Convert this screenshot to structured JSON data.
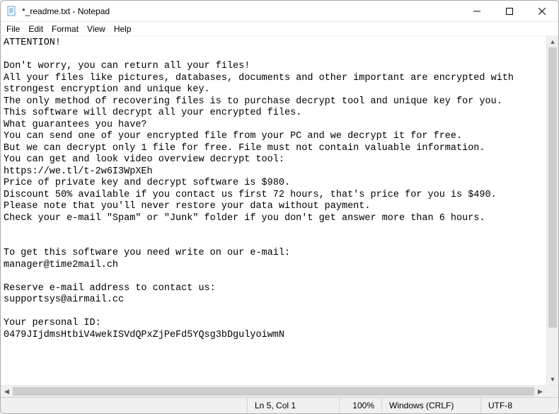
{
  "window": {
    "title": "*_readme.txt - Notepad"
  },
  "menubar": {
    "file": "File",
    "edit": "Edit",
    "format": "Format",
    "view": "View",
    "help": "Help"
  },
  "document": {
    "text": "ATTENTION!\n\nDon't worry, you can return all your files!\nAll your files like pictures, databases, documents and other important are encrypted with strongest encryption and unique key.\nThe only method of recovering files is to purchase decrypt tool and unique key for you.\nThis software will decrypt all your encrypted files.\nWhat guarantees you have?\nYou can send one of your encrypted file from your PC and we decrypt it for free.\nBut we can decrypt only 1 file for free. File must not contain valuable information.\nYou can get and look video overview decrypt tool:\nhttps://we.tl/t-2w6I3WpXEh\nPrice of private key and decrypt software is $980.\nDiscount 50% available if you contact us first 72 hours, that's price for you is $490.\nPlease note that you'll never restore your data without payment.\nCheck your e-mail \"Spam\" or \"Junk\" folder if you don't get answer more than 6 hours.\n\n\nTo get this software you need write on our e-mail:\nmanager@time2mail.ch\n\nReserve e-mail address to contact us:\nsupportsys@airmail.cc\n\nYour personal ID:\n0479JIjdmsHtbiV4wekISVdQPxZjPeFd5YQsg3bDgulyoiwmN"
  },
  "statusbar": {
    "lncol": "Ln 5, Col 1",
    "zoom": "100%",
    "eol": "Windows (CRLF)",
    "encoding": "UTF-8"
  }
}
